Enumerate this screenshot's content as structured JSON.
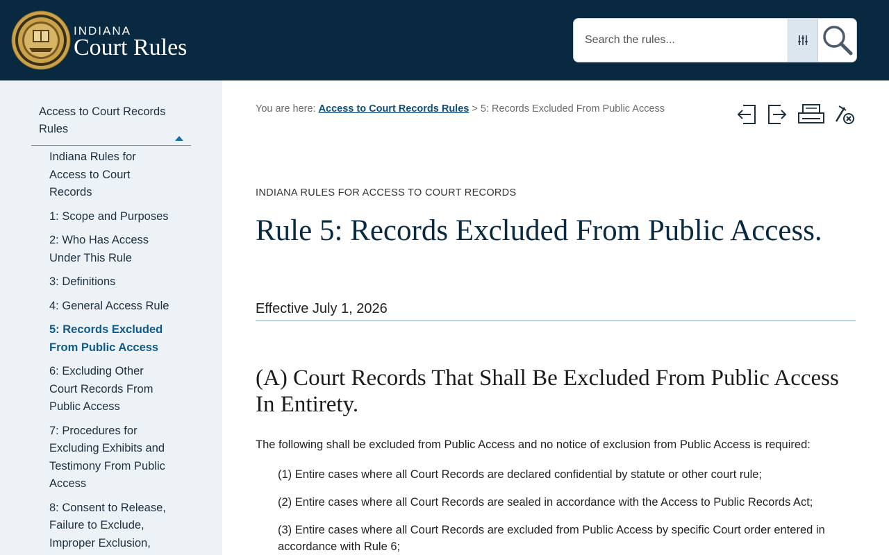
{
  "header": {
    "seal_alt": "Supreme Court State of Indiana seal",
    "brand_small": "INDIANA",
    "brand_big": "Court Rules",
    "search": {
      "placeholder": "Search the rules..."
    }
  },
  "sidebar": {
    "parent_label": "Access to Court Records Rules",
    "items": [
      {
        "label": "Indiana Rules for Access to Court Records",
        "active": false
      },
      {
        "label": "1: Scope and Purposes",
        "active": false
      },
      {
        "label": "2: Who Has Access Under This Rule",
        "active": false
      },
      {
        "label": "3: Definitions",
        "active": false
      },
      {
        "label": "4: General Access Rule",
        "active": false
      },
      {
        "label": "5: Records Excluded From Public Access",
        "active": true
      },
      {
        "label": "6: Excluding Other Court Records From Public Access",
        "active": false
      },
      {
        "label": "7: Procedures for Excluding Exhibits and Testimony From Public Access",
        "active": false
      },
      {
        "label": "8: Consent to Release, Failure to Exclude, Improper Exclusion,",
        "active": false
      }
    ]
  },
  "breadcrumb": {
    "prefix": "You are here:",
    "link": "Access to Court Records Rules",
    "separator": ">",
    "current": "5: Records Excluded From Public Access"
  },
  "tools": [
    "previous-rule-icon",
    "next-rule-icon",
    "print-icon",
    "clear-highlights-icon"
  ],
  "content": {
    "eyebrow": "INDIANA RULES FOR ACCESS TO COURT RECORDS",
    "title": "Rule 5: Records Excluded From Public Access.",
    "effective": "Effective July 1, 2026",
    "section_title": "(A) Court Records That Shall Be Excluded From Public Access In Entirety.",
    "intro": "The following shall be excluded from Public Access and no notice of exclusion from Public Access is required:",
    "items": [
      "(1) Entire cases where all Court Records are declared confidential by statute or other court rule;",
      "(2) Entire cases where all Court Records are sealed in accordance with the Access to Public Records Act;",
      "(3) Entire cases where all Court Records are excluded from Public Access by specific Court order entered in accordance with Rule 6;"
    ]
  },
  "colors": {
    "header_bg": "#082940",
    "sidebar_bg": "#edf2f7",
    "accent": "#0e5a8a",
    "seal_gold": "#c9a24a"
  }
}
